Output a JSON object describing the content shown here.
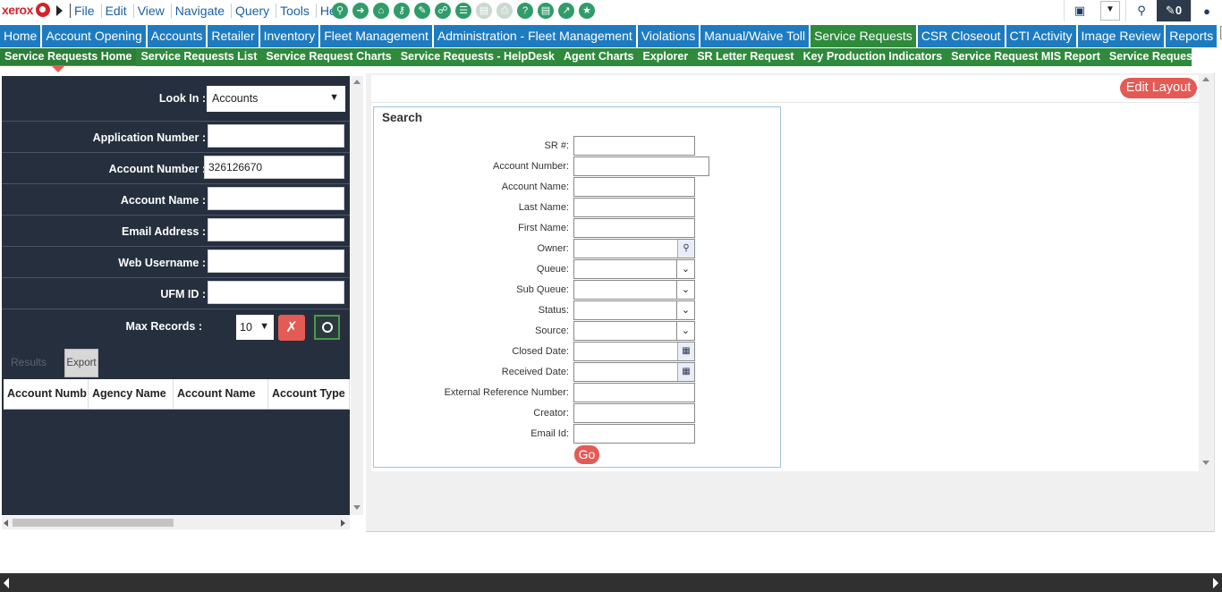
{
  "brand": {
    "logo_text": "xerox"
  },
  "menu": [
    "File",
    "Edit",
    "View",
    "Navigate",
    "Query",
    "Tools",
    "Help"
  ],
  "toolbar_icons": [
    "zoom-icon",
    "forward-icon",
    "home-icon",
    "key-icon",
    "clipboard-icon",
    "link-icon",
    "list-icon",
    "doc-icon",
    "print-icon",
    "help-icon",
    "notes-icon",
    "chart-icon",
    "star-icon"
  ],
  "top_right": {
    "notifications_count": "0"
  },
  "modules": [
    {
      "label": "Home",
      "active": false
    },
    {
      "label": "Account Opening",
      "active": false
    },
    {
      "label": "Accounts",
      "active": false
    },
    {
      "label": "Retailer",
      "active": false
    },
    {
      "label": "Inventory",
      "active": false
    },
    {
      "label": "Fleet Management",
      "active": false
    },
    {
      "label": "Administration - Fleet Management",
      "active": false
    },
    {
      "label": "Violations",
      "active": false
    },
    {
      "label": "Manual/Waive Toll",
      "active": false
    },
    {
      "label": "Service Requests",
      "active": true
    },
    {
      "label": "CSR Closeout",
      "active": false
    },
    {
      "label": "CTI Activity",
      "active": false
    },
    {
      "label": "Image Review",
      "active": false
    },
    {
      "label": "Reports",
      "active": false
    }
  ],
  "subnav": [
    {
      "label": "Service Requests Home",
      "active": true
    },
    {
      "label": "Service Requests List",
      "active": false
    },
    {
      "label": "Service Request Charts",
      "active": false
    },
    {
      "label": "Service Requests - HelpDesk",
      "active": false
    },
    {
      "label": "Agent Charts",
      "active": false
    },
    {
      "label": "Explorer",
      "active": false
    },
    {
      "label": "SR Letter Request",
      "active": false
    },
    {
      "label": "Key Production Indicators",
      "active": false
    },
    {
      "label": "Service Request MIS Report",
      "active": false
    },
    {
      "label": "Service Request Dashboard",
      "active": false
    }
  ],
  "left_panel": {
    "look_in_label": "Look In :",
    "look_in_value": "Accounts",
    "fields": [
      {
        "label": "Application Number :",
        "value": ""
      },
      {
        "label": "Account Number :",
        "value": "326126670"
      },
      {
        "label": "Account Name :",
        "value": ""
      },
      {
        "label": "Email Address :",
        "value": ""
      },
      {
        "label": "Web Username :",
        "value": ""
      },
      {
        "label": "UFM ID :",
        "value": ""
      }
    ],
    "max_records_label": "Max Records :",
    "max_records_value": "10",
    "tabs": {
      "results": "Results",
      "export": "Export"
    },
    "columns": [
      "Account Numb",
      "Agency Name",
      "Account Name",
      "Account Type"
    ]
  },
  "right_pane": {
    "edit_layout_label": "Edit Layout",
    "search": {
      "title": "Search",
      "fields": [
        {
          "label": "SR #:",
          "type": "text"
        },
        {
          "label": "Account Number:",
          "type": "text-wide"
        },
        {
          "label": "Account Name:",
          "type": "text"
        },
        {
          "label": "Last Name:",
          "type": "text"
        },
        {
          "label": "First Name:",
          "type": "text"
        },
        {
          "label": "Owner:",
          "type": "lookup"
        },
        {
          "label": "Queue:",
          "type": "select"
        },
        {
          "label": "Sub Queue:",
          "type": "select"
        },
        {
          "label": "Status:",
          "type": "select"
        },
        {
          "label": "Source:",
          "type": "select"
        },
        {
          "label": "Closed Date:",
          "type": "date"
        },
        {
          "label": "Received Date:",
          "type": "date"
        },
        {
          "label": "External Reference Number:",
          "type": "text"
        },
        {
          "label": "Creator:",
          "type": "text"
        },
        {
          "label": "Email Id:",
          "type": "text"
        }
      ],
      "go_label": "Go"
    }
  }
}
